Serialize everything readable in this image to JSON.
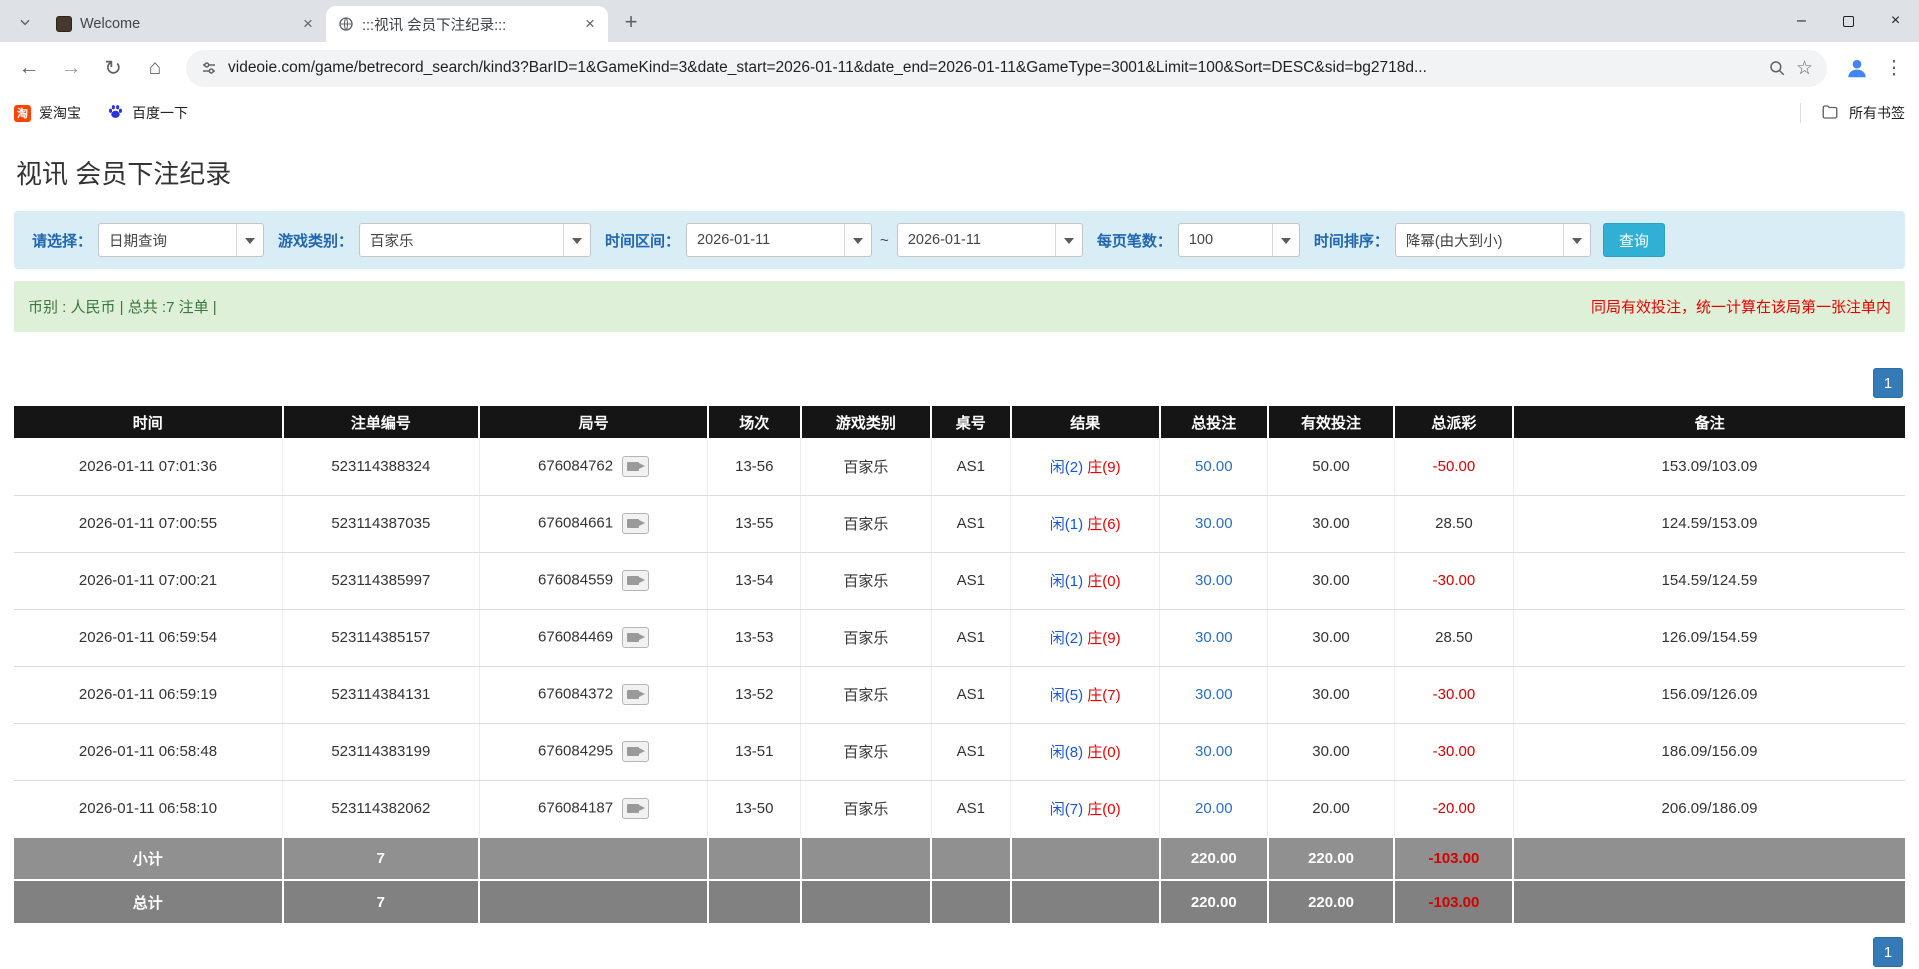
{
  "browser": {
    "tabs": [
      {
        "title": "Welcome"
      },
      {
        "title": ":::视讯 会员下注纪录:::"
      }
    ],
    "url": "videoie.com/game/betrecord_search/kind3?BarID=1&GameKind=3&date_start=2026-01-11&date_end=2026-01-11&GameType=3001&Limit=100&Sort=DESC&sid=bg2718d...",
    "bookmarks": [
      {
        "label": "爱淘宝"
      },
      {
        "label": "百度一下"
      }
    ],
    "all_bookmarks_label": "所有书签"
  },
  "icons": {
    "tab_close": "×",
    "new_tab": "+",
    "back": "←",
    "forward": "→",
    "refresh": "↻",
    "home": "⌂",
    "star": "☆",
    "menu_dots": "⋮",
    "minimize": "–",
    "window_close": "×",
    "taobao_glyph": "淘"
  },
  "page": {
    "title": "视讯 会员下注纪录",
    "filters": {
      "select_label": "请选择：",
      "select_value": "日期查询",
      "game_label": "游戏类别：",
      "game_value": "百家乐",
      "range_label": "时间区间：",
      "date_start": "2026-01-11",
      "range_separator": "~",
      "date_end": "2026-01-11",
      "per_page_label": "每页笔数：",
      "per_page_value": "100",
      "sort_label": "时间排序：",
      "sort_value": "降幂(由大到小)",
      "search_button_label": "查询"
    },
    "summary_bar": {
      "left_text": "币别 : 人民币 | 总共 :7 注单 |",
      "right_text": "同局有效投注，统一计算在该局第一张注单内"
    },
    "pagination": {
      "page_label": "1"
    },
    "table": {
      "headers": [
        "时间",
        "注单编号",
        "局号",
        "场次",
        "游戏类别",
        "桌号",
        "结果",
        "总投注",
        "有效投注",
        "总派彩",
        "备注"
      ],
      "rows": [
        {
          "time": "2026-01-11 07:01:36",
          "bet_no": "523114388324",
          "round_no": "676084762",
          "session": "13-56",
          "game": "百家乐",
          "table_no": "AS1",
          "result_player": "闲(2)",
          "result_banker": "庄(9)",
          "total_bet": "50.00",
          "valid_bet": "50.00",
          "payout": "-50.00",
          "remark": "153.09/103.09"
        },
        {
          "time": "2026-01-11 07:00:55",
          "bet_no": "523114387035",
          "round_no": "676084661",
          "session": "13-55",
          "game": "百家乐",
          "table_no": "AS1",
          "result_player": "闲(1)",
          "result_banker": "庄(6)",
          "total_bet": "30.00",
          "valid_bet": "30.00",
          "payout": "28.50",
          "remark": "124.59/153.09"
        },
        {
          "time": "2026-01-11 07:00:21",
          "bet_no": "523114385997",
          "round_no": "676084559",
          "session": "13-54",
          "game": "百家乐",
          "table_no": "AS1",
          "result_player": "闲(1)",
          "result_banker": "庄(0)",
          "total_bet": "30.00",
          "valid_bet": "30.00",
          "payout": "-30.00",
          "remark": "154.59/124.59"
        },
        {
          "time": "2026-01-11 06:59:54",
          "bet_no": "523114385157",
          "round_no": "676084469",
          "session": "13-53",
          "game": "百家乐",
          "table_no": "AS1",
          "result_player": "闲(2)",
          "result_banker": "庄(9)",
          "total_bet": "30.00",
          "valid_bet": "30.00",
          "payout": "28.50",
          "remark": "126.09/154.59"
        },
        {
          "time": "2026-01-11 06:59:19",
          "bet_no": "523114384131",
          "round_no": "676084372",
          "session": "13-52",
          "game": "百家乐",
          "table_no": "AS1",
          "result_player": "闲(5)",
          "result_banker": "庄(7)",
          "total_bet": "30.00",
          "valid_bet": "30.00",
          "payout": "-30.00",
          "remark": "156.09/126.09"
        },
        {
          "time": "2026-01-11 06:58:48",
          "bet_no": "523114383199",
          "round_no": "676084295",
          "session": "13-51",
          "game": "百家乐",
          "table_no": "AS1",
          "result_player": "闲(8)",
          "result_banker": "庄(0)",
          "total_bet": "30.00",
          "valid_bet": "30.00",
          "payout": "-30.00",
          "remark": "186.09/156.09"
        },
        {
          "time": "2026-01-11 06:58:10",
          "bet_no": "523114382062",
          "round_no": "676084187",
          "session": "13-50",
          "game": "百家乐",
          "table_no": "AS1",
          "result_player": "闲(7)",
          "result_banker": "庄(0)",
          "total_bet": "20.00",
          "valid_bet": "20.00",
          "payout": "-20.00",
          "remark": "206.09/186.09"
        }
      ],
      "subtotal": {
        "label": "小计",
        "count": "7",
        "total_bet": "220.00",
        "valid_bet": "220.00",
        "payout": "-103.00"
      },
      "grand_total": {
        "label": "总计",
        "count": "7",
        "total_bet": "220.00",
        "valid_bet": "220.00",
        "payout": "-103.00"
      }
    }
  }
}
